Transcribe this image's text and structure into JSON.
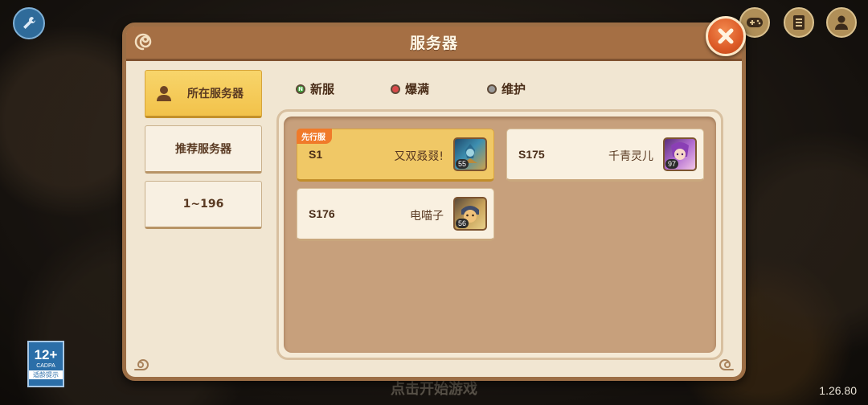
{
  "dialog": {
    "title": "服务器"
  },
  "tabs": [
    {
      "label": "所在服务器",
      "active": true
    },
    {
      "label": "推荐服务器",
      "active": false
    },
    {
      "label": "1~196",
      "active": false
    }
  ],
  "legend": [
    {
      "label": "新服",
      "color": "#3ea43a",
      "marker": "N"
    },
    {
      "label": "爆满",
      "color": "#d94a4a",
      "marker": ""
    },
    {
      "label": "维护",
      "color": "#9a9a9a",
      "marker": ""
    }
  ],
  "servers": [
    {
      "id": "S1",
      "player": "又双叒叕!",
      "level": "55",
      "badge": "先行服",
      "selected": true
    },
    {
      "id": "S175",
      "player": "千青灵儿",
      "level": "97",
      "badge": "",
      "selected": false
    },
    {
      "id": "S176",
      "player": "电喵子",
      "level": "56",
      "badge": "",
      "selected": false
    }
  ],
  "age_rating": {
    "value": "12+",
    "org": "CADPA",
    "tip": "适龄提示"
  },
  "footer": {
    "tap_hint": "点击开始游戏",
    "version": "1.26.80"
  },
  "icons": [
    "wrench-icon",
    "gamepad-icon",
    "notes-icon",
    "user-icon",
    "close-icon",
    "user-silhouette-icon"
  ]
}
